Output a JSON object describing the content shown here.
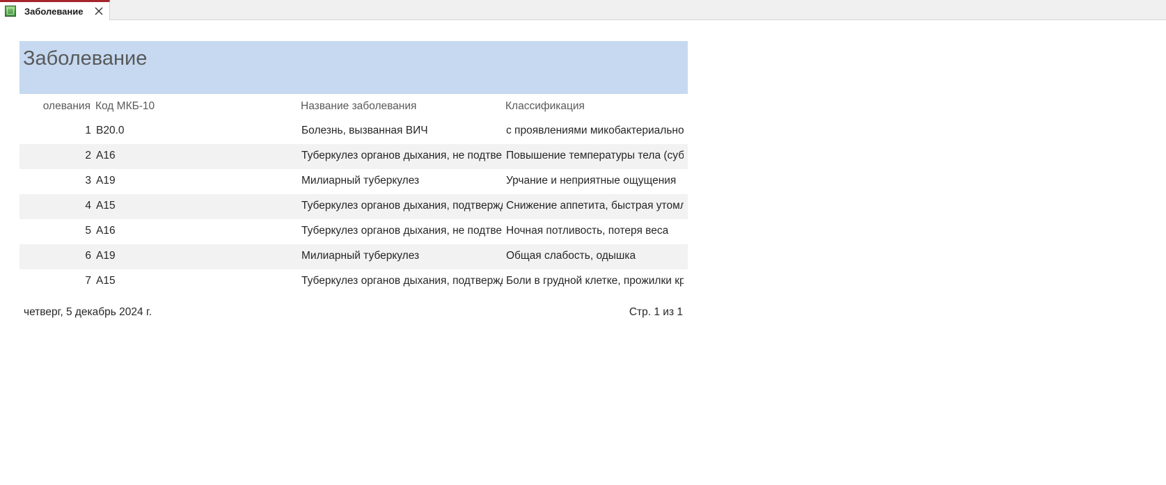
{
  "tab": {
    "icon": "report-icon",
    "label": "Заболевание",
    "close_icon": "close-icon"
  },
  "report": {
    "title": "Заболевание",
    "header_bg": "#c6d9f1",
    "columns": {
      "id": "олевания",
      "code": "Код МКБ-10",
      "name": "Название заболевания",
      "classification": "Классификация"
    },
    "rows": [
      {
        "id": "1",
        "code": "B20.0",
        "name": "Болезнь, вызванная ВИЧ",
        "classification": "с проявлениями микобактериальной"
      },
      {
        "id": "2",
        "code": "A16",
        "name": "Туберкулез органов дыхания, не подтвержденный",
        "classification": "Повышение температуры тела (субфебрильная)"
      },
      {
        "id": "3",
        "code": "A19",
        "name": "Милиарный туберкулез",
        "classification": "Урчание и неприятные ощущения"
      },
      {
        "id": "4",
        "code": "A15",
        "name": "Туберкулез органов дыхания, подтвержденный",
        "classification": "Снижение аппетита, быстрая утомляемость"
      },
      {
        "id": "5",
        "code": "A16",
        "name": "Туберкулез органов дыхания, не подтвержденный",
        "classification": "Ночная потливость, потеря веса"
      },
      {
        "id": "6",
        "code": "A19",
        "name": "Милиарный туберкулез",
        "classification": "Общая слабость, одышка"
      },
      {
        "id": "7",
        "code": "A15",
        "name": "Туберкулез органов дыхания, подтвержденный",
        "classification": "Боли в грудной клетке, прожилки крови"
      }
    ],
    "footer": {
      "date": "четверг, 5 декабрь 2024 г.",
      "page": "Стр. 1 из 1"
    }
  }
}
